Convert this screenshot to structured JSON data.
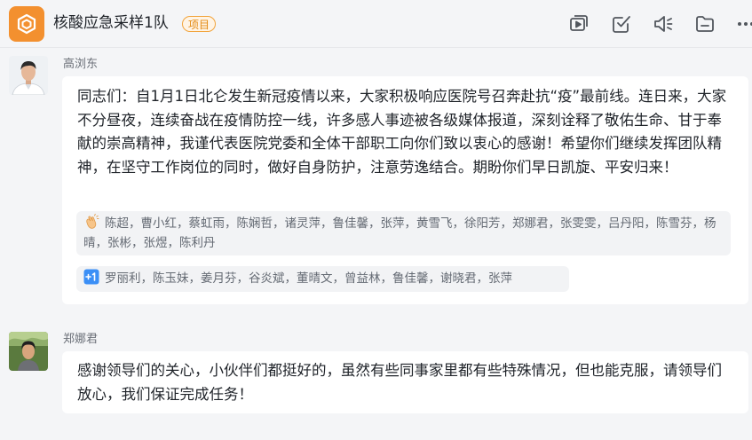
{
  "header": {
    "title": "核酸应急采样1队",
    "tag": "项目",
    "toolbar": [
      "video-meeting-icon",
      "task-check-icon",
      "announcement-icon",
      "folder-icon",
      "more-icon"
    ]
  },
  "messages": [
    {
      "sender": "高浏东",
      "text": "同志们：自1月1日北仑发生新冠疫情以来，大家积极响应医院号召奔赴抗“疫”最前线。连日来，大家不分昼夜，连续奋战在疫情防控一线，许多感人事迹被各级媒体报道，深刻诠释了敬佑生命、甘于奉献的崇高精神，我谨代表医院党委和全体干部职工向你们致以衷心的感谢！希望你们继续发挥团队精神，在坚守工作岗位的同时，做好自身防护，注意劳逸结合。期盼你们早日凯旋、平安归来！",
      "reactions": [
        {
          "icon": "clap-icon",
          "names": "陈超，曹小红，蔡虹雨，陈娴哲，诸灵萍，鲁佳馨，张萍，黄雪飞，徐阳芳，郑娜君，张雯雯，吕丹阳，陈雪芬，杨晴，张彬，张煜，陈利丹"
        },
        {
          "icon": "plus-one-icon",
          "names": "罗丽利，陈玉妹，姜月芬，谷炎斌，董晴文，曾益林，鲁佳馨，谢晓君，张萍"
        }
      ]
    },
    {
      "sender": "郑娜君",
      "text": "感谢领导们的关心，小伙伴们都挺好的，虽然有些同事家里都有些特殊情况，但也能克服，请领导们放心，我们保证完成任务！"
    }
  ],
  "colors": {
    "accent": "#f3902f",
    "background": "#f4f5f7",
    "bubble": "#ffffff",
    "reaction_bg": "#f2f3f5",
    "tag_text": "#e38a12"
  }
}
